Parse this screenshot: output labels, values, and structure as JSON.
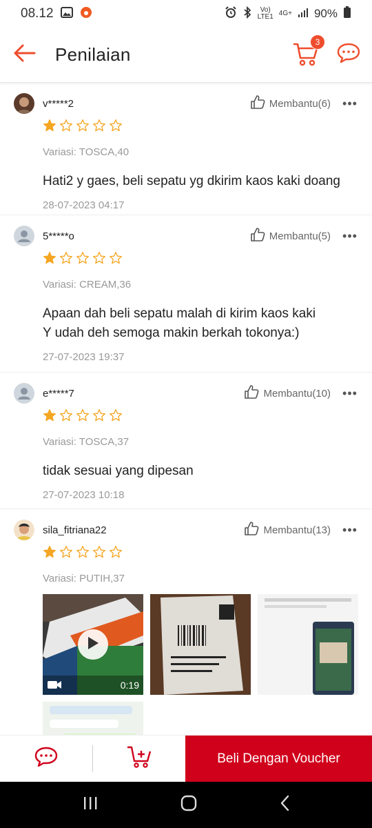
{
  "status_bar": {
    "time": "08.12",
    "battery": "90%",
    "network": "4G+",
    "network_sub": "LTE1",
    "volte": "Vo)"
  },
  "app_bar": {
    "title": "Penilaian",
    "cart_count": "3",
    "icons": [
      "back-arrow-icon",
      "cart-icon",
      "chat-icon"
    ]
  },
  "colors": {
    "brand": "#ee4d2d",
    "buy_button": "#d0011b",
    "star": "#f5a623"
  },
  "reviews": [
    {
      "username": "v*****2",
      "helpful_label": "Membantu(6)",
      "rating": 1,
      "variant": "Variasi: TOSCA,40",
      "comment_lines": [
        "Hati2 y gaes, beli sepatu yg dkirim kaos kaki doang"
      ],
      "date": "28-07-2023 04:17"
    },
    {
      "username": "5*****o",
      "helpful_label": "Membantu(5)",
      "rating": 1,
      "variant": "Variasi: CREAM,36",
      "comment_lines": [
        "Apaan dah beli sepatu malah di kirim kaos kaki",
        "Y udah deh semoga makin berkah tokonya:)"
      ],
      "date": "27-07-2023 19:37"
    },
    {
      "username": "e*****7",
      "helpful_label": "Membantu(10)",
      "rating": 1,
      "variant": "Variasi: TOSCA,37",
      "comment_lines": [
        "tidak sesuai yang dipesan"
      ],
      "date": "27-07-2023 10:18"
    },
    {
      "username": "sila_fitriana22",
      "helpful_label": "Membantu(13)",
      "rating": 1,
      "variant": "Variasi: PUTIH,37",
      "video_duration": "0:19"
    }
  ],
  "bottom_bar": {
    "buy_label": "Beli Dengan Voucher"
  }
}
